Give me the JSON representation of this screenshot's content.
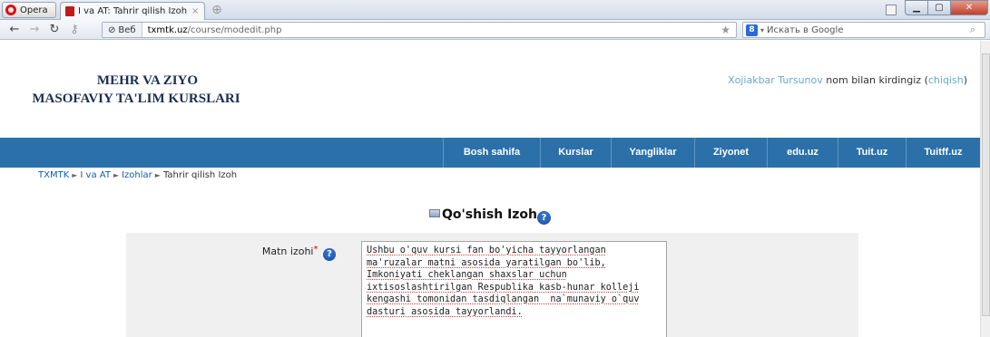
{
  "browser": {
    "menu_label": "Opera",
    "tab_title": "I va AT: Tahrir qilish Izoh",
    "tab_close": "×",
    "web_badge": "Веб",
    "url_host": "txmtk.uz",
    "url_path": "/course/modedit.php",
    "search_placeholder": "Искать в Google",
    "search_engine_letter": "8"
  },
  "header": {
    "logo_line1": "MEHR VA ZIYO",
    "logo_line2": "MASOFAVIY TA'LIM KURSLARI",
    "user_name": "Xojiakbar Tursunov",
    "login_text": "nom bilan kirdingiz",
    "logout_label": "chiqish"
  },
  "nav": [
    {
      "label": "Bosh sahifa"
    },
    {
      "label": "Kurslar"
    },
    {
      "label": "Yangliklar"
    },
    {
      "label": "Ziyonet"
    },
    {
      "label": "edu.uz"
    },
    {
      "label": "Tuit.uz"
    },
    {
      "label": "Tuitff.uz"
    }
  ],
  "breadcrumb": {
    "items": [
      "TXMTK",
      "I va AT",
      "Izohlar"
    ],
    "current": "Tahrir qilish Izoh"
  },
  "page_title": "Qo'shish Izoh",
  "form": {
    "label": "Matn izohi",
    "required_mark": "*",
    "text_lines": [
      "Ushbu o'quv kursi fan bo'yicha tayyorlangan",
      "ma'ruzalar matni asosida yaratilgan bo'lib,",
      "Imkoniyati cheklangan shaxslar uchun",
      "ixtisoslashtirilgan Respublika kasb-hunar kolleji",
      "kengashi tomonidan tasdiqlangan  na`munaviy o`quv",
      "dasturi asosida tayyorlandi."
    ]
  },
  "colors": {
    "navbar": "#2b70a9",
    "logo": "#1b2e53",
    "link": "#0f5fa8",
    "user_link": "#68a9c8"
  }
}
